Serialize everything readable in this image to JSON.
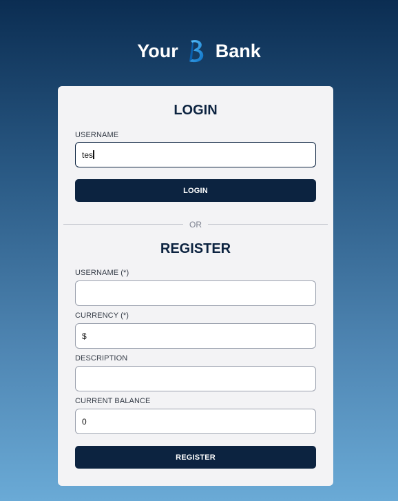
{
  "brand": {
    "left_word": "Your",
    "right_word": "Bank",
    "logo_icon": "b-logo-icon",
    "logo_color": "#1a8fe0"
  },
  "colors": {
    "primary": "#0c2340",
    "card_bg": "#f3f3f5",
    "gradient_top": "#0b2d52",
    "gradient_bottom": "#6aaad6"
  },
  "login": {
    "title": "LOGIN",
    "username_label": "USERNAME",
    "username_value": "tes",
    "button_label": "LOGIN"
  },
  "divider": {
    "text": "OR"
  },
  "register": {
    "title": "REGISTER",
    "username_label": "USERNAME (*)",
    "username_value": "",
    "currency_label": "CURRENCY (*)",
    "currency_value": "$",
    "description_label": "DESCRIPTION",
    "description_value": "",
    "balance_label": "CURRENT BALANCE",
    "balance_value": "0",
    "button_label": "REGISTER"
  }
}
